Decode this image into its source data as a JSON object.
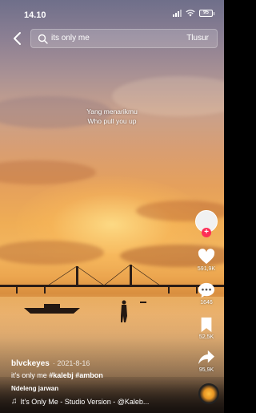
{
  "status_bar": {
    "time": "14.10",
    "battery": "95"
  },
  "search": {
    "query": "its only me",
    "submit_label": "Tlusur"
  },
  "lyrics": {
    "line1": "Yang menarikmu",
    "line2": "Who pull you up"
  },
  "actions": {
    "likes": "591,9K",
    "comments": "1646",
    "saves": "52,5K",
    "shares": "95,9K"
  },
  "post": {
    "username": "blvckeyes",
    "date": "· 2021-8-16",
    "caption_text": "it's only me ",
    "hashtags": "#kalebj #ambon",
    "translate_label": "Ndeleng jarwan",
    "music": "It's Only Me - Studio Version - @Kaleb..."
  },
  "colors": {
    "accent_red": "#fe2c55"
  },
  "icons": {
    "back": "chevron-left-icon",
    "search": "search-icon",
    "like": "heart-icon",
    "comment": "comment-icon",
    "save": "bookmark-icon",
    "share": "share-icon",
    "music": "music-note-icon"
  }
}
